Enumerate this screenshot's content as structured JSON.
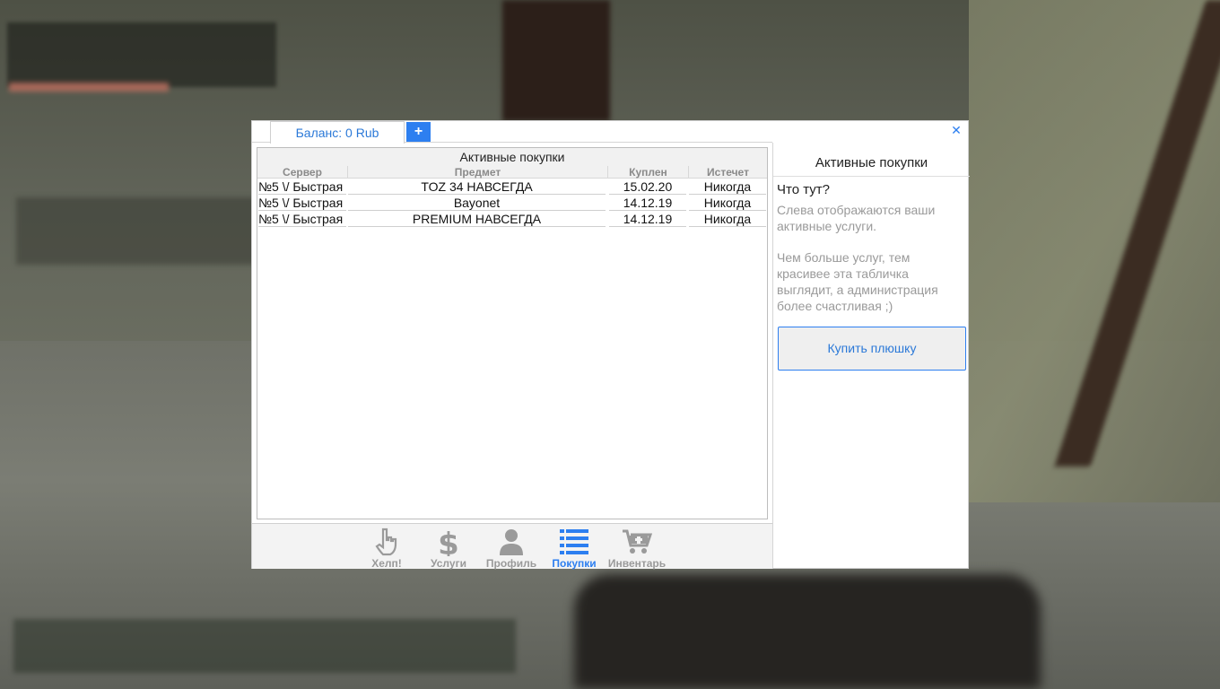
{
  "header": {
    "balance_tab": "Баланс: 0 Rub",
    "plus_label": "+",
    "close_label": "✕"
  },
  "table": {
    "title": "Активные покупки",
    "columns": [
      "Сервер",
      "Предмет",
      "Куплен",
      "Истечет"
    ],
    "rows": [
      [
        "№5 \\/ Быстрая",
        "TOZ 34 НАВСЕГДА",
        "15.02.20",
        "Никогда"
      ],
      [
        "№5 \\/ Быстрая",
        "Bayonet",
        "14.12.19",
        "Никогда"
      ],
      [
        "№5 \\/ Быстрая",
        "PREMIUM НАВСЕГДА",
        "14.12.19",
        "Никогда"
      ]
    ]
  },
  "nav": {
    "items": [
      {
        "label": "Хелп!",
        "icon": "hand-pointer-icon"
      },
      {
        "label": "Услуги",
        "icon": "dollar-icon"
      },
      {
        "label": "Профиль",
        "icon": "user-icon"
      },
      {
        "label": "Покупки",
        "icon": "list-icon"
      },
      {
        "label": "Инвентарь",
        "icon": "cart-plus-icon"
      }
    ],
    "active": "Покупки",
    "active_color": "#2d7ff0",
    "inactive_color": "#9a9a9a"
  },
  "side": {
    "title": "Активные покупки",
    "question": "Что тут?",
    "text1": "Слева отображаются ваши активные услуги.",
    "text2": "Чем больше услуг, тем красивее эта табличка выглядит, а администрация более счастливая ;)",
    "buy_button": "Купить плюшку"
  }
}
